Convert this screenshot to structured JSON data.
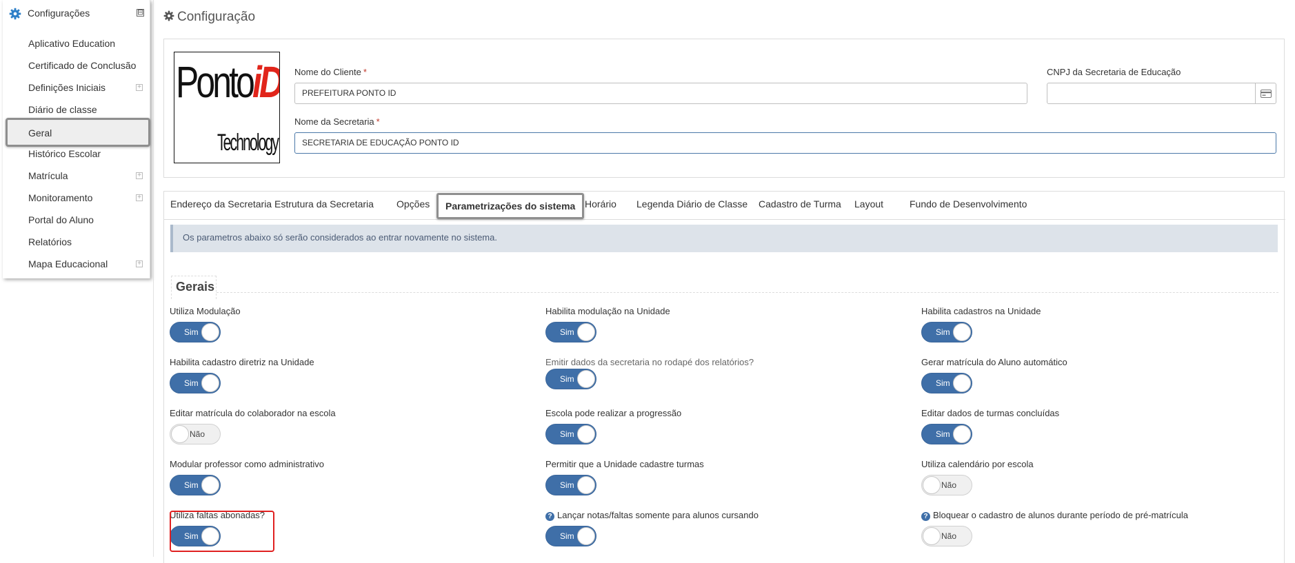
{
  "sidebar": {
    "title": "Configurações",
    "collapse_symbol": "⊟",
    "items": [
      {
        "label": "Aplicativo Education",
        "expandable": false
      },
      {
        "label": "Certificado de Conclusão",
        "expandable": false
      },
      {
        "label": "Definições Iniciais",
        "expandable": true
      },
      {
        "label": "Diário de classe",
        "expandable": false
      },
      {
        "label": "Geral",
        "expandable": false,
        "active": true
      },
      {
        "label": "Histórico Escolar",
        "expandable": false
      },
      {
        "label": "Matrícula",
        "expandable": true
      },
      {
        "label": "Monitoramento",
        "expandable": true
      },
      {
        "label": "Portal do Aluno",
        "expandable": false
      },
      {
        "label": "Relatórios",
        "expandable": false
      },
      {
        "label": "Mapa Educacional",
        "expandable": true
      }
    ]
  },
  "page": {
    "title": "Configuração"
  },
  "client": {
    "logo_text_main": "Ponto",
    "logo_text_id": "iD",
    "logo_text_sub": "Technology",
    "nome_cliente_label": "Nome do Cliente",
    "nome_cliente_value": "PREFEITURA PONTO ID",
    "cnpj_label": "CNPJ da Secretaria de Educação",
    "cnpj_value": "",
    "nome_secretaria_label": "Nome da Secretaria",
    "nome_secretaria_value": "SECRETARIA DE EDUCAÇÃO PONTO ID",
    "required_mark": "*"
  },
  "tabs": [
    {
      "label": "Endereço da Secretaria"
    },
    {
      "label": "Estrutura da Secretaria"
    },
    {
      "label": "Opções"
    },
    {
      "label": "Parametrizações do sistema",
      "active": true
    },
    {
      "label": "Horário"
    },
    {
      "label": "Legenda Diário de Classe"
    },
    {
      "label": "Cadastro de Turma"
    },
    {
      "label": "Layout"
    },
    {
      "label": "Fundo de Desenvolvimento"
    }
  ],
  "alert": {
    "text": "Os parametros abaixo só serão considerados ao entrar novamente no sistema."
  },
  "section": {
    "title": "Gerais"
  },
  "options": [
    {
      "label": "Utiliza Modulação",
      "value": "Sim",
      "on": true
    },
    {
      "label": "Habilita modulação na Unidade",
      "value": "Sim",
      "on": true
    },
    {
      "label": "Habilita cadastros na Unidade",
      "value": "Sim",
      "on": true
    },
    {
      "label": "Habilita cadastro diretriz na Unidade",
      "value": "Sim",
      "on": true
    },
    {
      "label": "Emitir dados da secretaria no rodapé dos relatórios?",
      "value": "Sim",
      "on": true
    },
    {
      "label": "Gerar matrícula do Aluno automático",
      "value": "Sim",
      "on": true
    },
    {
      "label": "Editar matrícula do colaborador na escola",
      "value": "Não",
      "on": false
    },
    {
      "label": "Escola pode realizar a progressão",
      "value": "Sim",
      "on": true
    },
    {
      "label": "Editar dados de turmas concluídas",
      "value": "Sim",
      "on": true
    },
    {
      "label": "Modular professor como administrativo",
      "value": "Sim",
      "on": true
    },
    {
      "label": "Permitir que a Unidade cadastre turmas",
      "value": "Sim",
      "on": true
    },
    {
      "label": "Utiliza calendário por escola",
      "value": "Não",
      "on": false
    },
    {
      "label": "Utiliza faltas abonadas?",
      "value": "Sim",
      "on": true
    },
    {
      "label": "Lançar notas/faltas somente para alunos cursando",
      "value": "Sim",
      "on": true,
      "help": true
    },
    {
      "label": "Bloquear o cadastro de alunos durante período de pré-matrícula",
      "value": "Não",
      "on": false,
      "help": true
    }
  ],
  "help_symbol": "?",
  "colors": {
    "toggle_on": "#3f6fa8",
    "highlight": "#e02020",
    "active_outline": "#8f8f8f"
  }
}
